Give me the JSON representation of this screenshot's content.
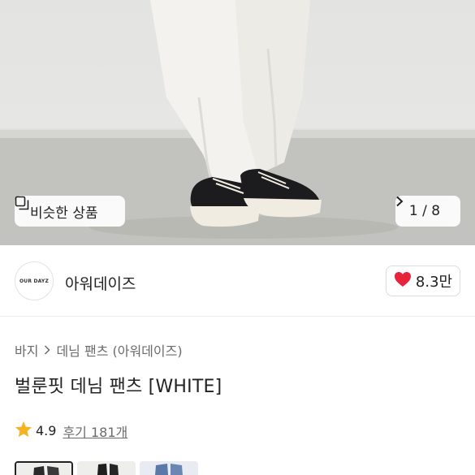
{
  "hero": {
    "similar_button_label": "비슷한 상품",
    "pager_text": "1 / 8"
  },
  "brand": {
    "logo_text": "OUR DAYZ",
    "name": "아워데이즈",
    "like_count": "8.3만"
  },
  "breadcrumb": {
    "items": [
      "바지",
      "데님 팬츠 (아워데이즈)"
    ]
  },
  "product": {
    "title": "벌룬핏 데님 팬츠 [WHITE]",
    "rating": "4.9",
    "reviews_label": "후기 181개"
  },
  "colors": {
    "heart": "#e8243c",
    "star": "#f5b324"
  }
}
